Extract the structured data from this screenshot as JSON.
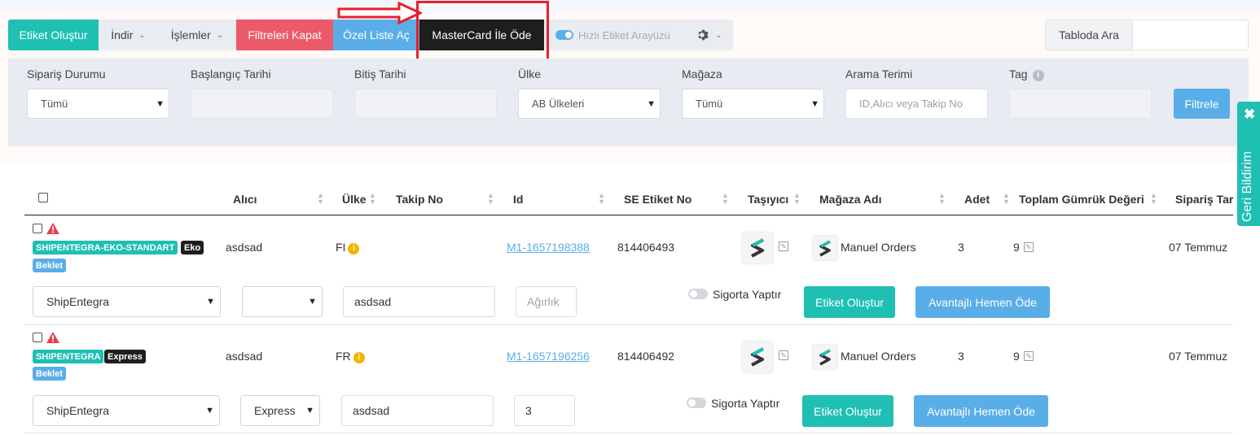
{
  "toolbar": {
    "create_label": "Etiket Oluştur",
    "download_label": "İndir",
    "actions_label": "İşlemler",
    "close_filters_label": "Filtreleri Kapat",
    "custom_list_label": "Özel Liste Aç",
    "mastercard_label": "MasterCard İle Öde",
    "quick_label_label": "Hızlı Etiket Arayüzü",
    "table_search_label": "Tabloda Ara"
  },
  "filters": {
    "order_status_label": "Sipariş Durumu",
    "order_status_value": "Tümü",
    "start_date_label": "Başlangıç Tarihi",
    "end_date_label": "Bitiş Tarihi",
    "country_label": "Ülke",
    "country_value": "AB Ülkeleri",
    "store_label": "Mağaza",
    "store_value": "Tümü",
    "search_term_label": "Arama Terimi",
    "search_term_placeholder": "ID,Alıcı veya Takip No",
    "tag_label": "Tag",
    "filter_button": "Filtrele"
  },
  "feedback": {
    "label": "Geri Bildirim"
  },
  "table": {
    "headers": [
      "Alıcı",
      "Ülke",
      "Takip No",
      "Id",
      "SE Etiket No",
      "Taşıyıcı",
      "Mağaza Adı",
      "Adet",
      "Toplam Gümrük Değeri",
      "Sipariş Tar"
    ],
    "rows": [
      {
        "tags": [
          "SHIPENTEGRA-EKO-STANDART",
          "Eko",
          "Beklet"
        ],
        "recipient": "asdsad",
        "country": "FI",
        "id": "M1-1657198388",
        "se_label": "814406493",
        "store": "Manuel Orders",
        "qty": "3",
        "customs": "9",
        "date": "07 Temmuz",
        "carrier_select": "ShipEntegra",
        "service_select": "",
        "recipient_input": "asdsad",
        "weight_input": "",
        "weight_placeholder": "Ağırlık",
        "insurance_label": "Sigorta Yaptır",
        "create_button": "Etiket Oluştur",
        "pay_button": "Avantajlı Hemen Öde"
      },
      {
        "tags": [
          "SHIPENTEGRA",
          "Express",
          "Beklet"
        ],
        "recipient": "asdsad",
        "country": "FR",
        "id": "M1-1657196256",
        "se_label": "814406492",
        "store": "Manuel Orders",
        "qty": "3",
        "customs": "9",
        "date": "07 Temmuz",
        "carrier_select": "ShipEntegra",
        "service_select": "Express",
        "recipient_input": "asdsad",
        "weight_input": "3",
        "weight_placeholder": "",
        "insurance_label": "Sigorta Yaptır",
        "create_button": "Etiket Oluştur",
        "pay_button": "Avantajlı Hemen Öde"
      }
    ]
  },
  "colors": {
    "teal": "#1fbfb3",
    "red": "#ec5a6a",
    "blue": "#5aaee8",
    "dark": "#1e1e1e",
    "highlight": "#e8202a"
  },
  "icons": [
    "gear-icon",
    "chevron-down-icon",
    "warning-icon",
    "info-icon",
    "close-icon",
    "shipentegra-logo",
    "edit-icon",
    "red-arrow-annotation"
  ]
}
